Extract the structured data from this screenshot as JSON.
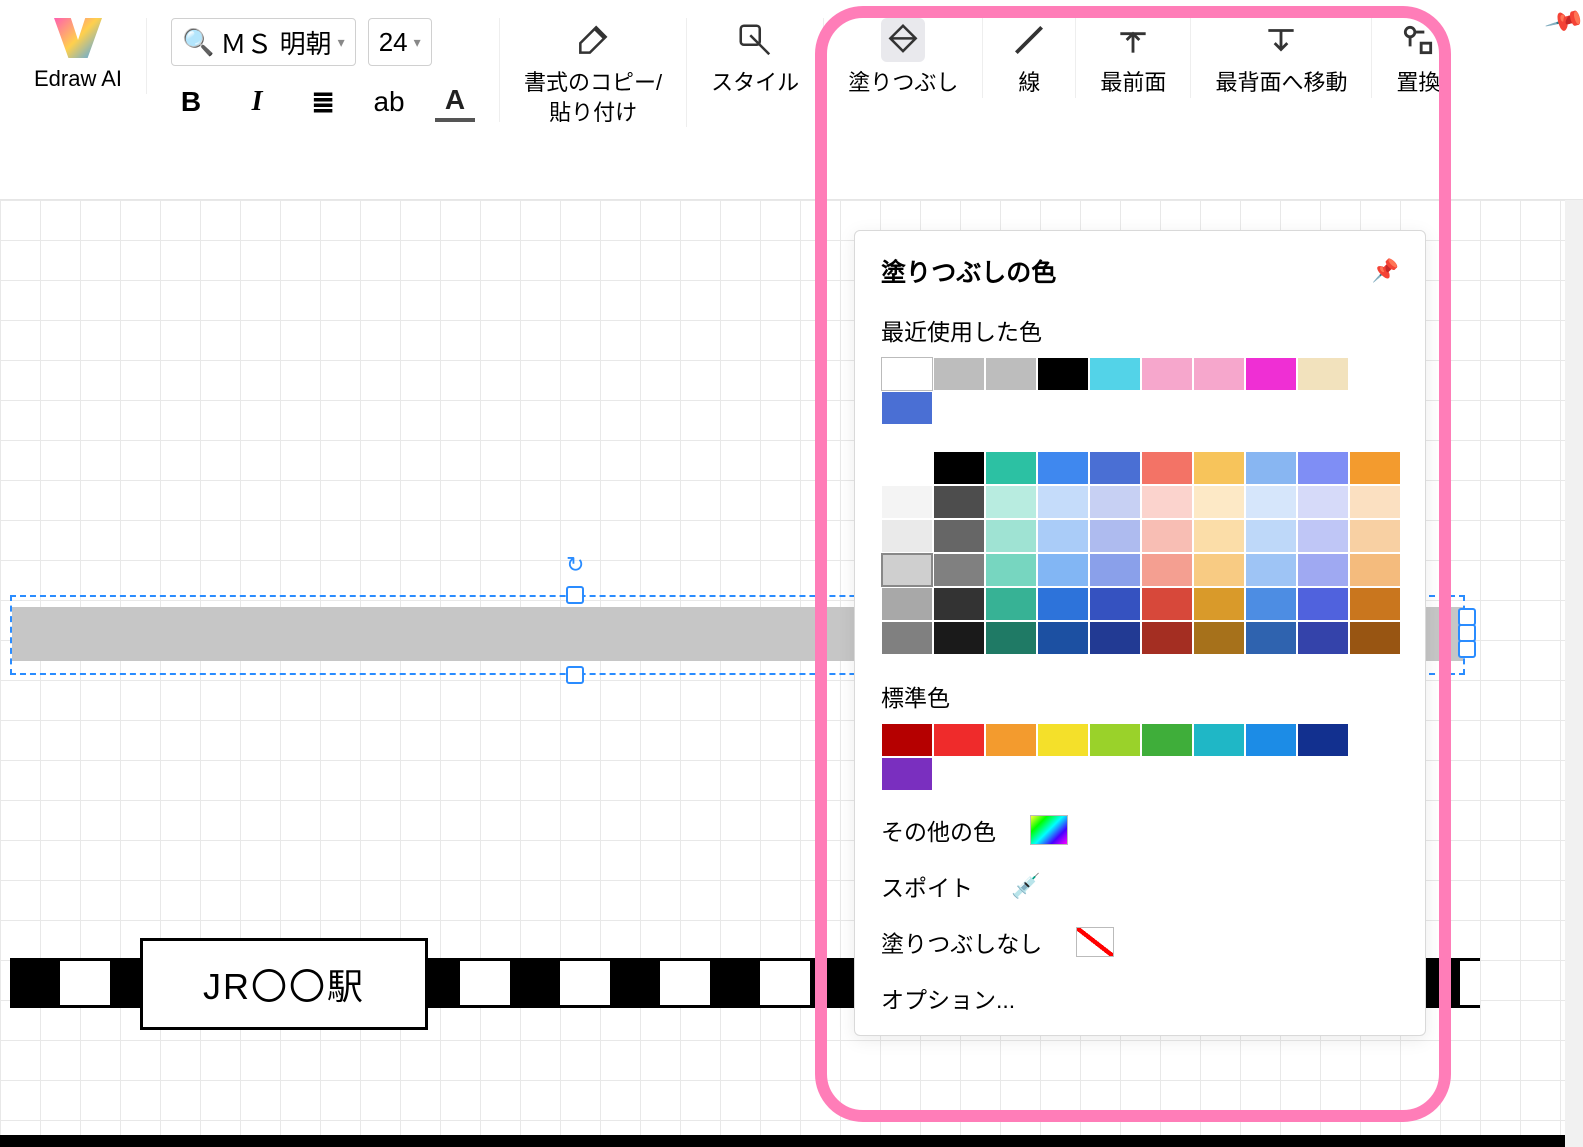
{
  "toolbar": {
    "ai_label": "Edraw AI",
    "font_name": "ＭＳ 明朝",
    "font_size": "24",
    "format_copy_label": "書式のコピー/\n貼り付け",
    "style_label": "スタイル",
    "fill_label": "塗りつぶし",
    "line_label": "線",
    "front_label": "最前面",
    "back_label": "最背面へ移動",
    "replace_label": "置換",
    "char_bold": "B",
    "char_italic": "I",
    "char_align_icon": "≣",
    "char_ab": "ab",
    "char_A": "A"
  },
  "canvas": {
    "station_text": "JR〇〇駅"
  },
  "popup": {
    "title": "塗りつぶしの色",
    "recent_label": "最近使用した色",
    "recent_colors": [
      "#ffffff",
      "#bdbdbd",
      "#bdbdbd",
      "#000000",
      "#53d3e8",
      "#f6a7cc",
      "#f6a7cc",
      "#ef2fd4",
      "#f2e2bd",
      "#4a6fd4"
    ],
    "palette": [
      [
        "#ffffff",
        "#000000",
        "#2cc1a3",
        "#3f88ef",
        "#4a6fd4",
        "#f37366",
        "#f7c45b",
        "#88b6f2",
        "#7f8ef5",
        "#f39b2e"
      ],
      [
        "#f4f4f4",
        "#4d4d4d",
        "#b8ece0",
        "#c5dcfa",
        "#c7d0f3",
        "#fbd3cd",
        "#fde9c6",
        "#d6e6fb",
        "#d6daf9",
        "#fbe0c1"
      ],
      [
        "#eaeaea",
        "#666666",
        "#9fe3d3",
        "#aaccf8",
        "#aebbef",
        "#f8beb4",
        "#fbdda8",
        "#bed8f9",
        "#bfc6f6",
        "#f8d0a3"
      ],
      [
        "#cfcfcf",
        "#808080",
        "#77d6c0",
        "#82b6f4",
        "#8aa0ea",
        "#f49f91",
        "#f8cb83",
        "#9ec4f5",
        "#9fa9f2",
        "#f4bb7d"
      ],
      [
        "#a8a8a8",
        "#333333",
        "#37b295",
        "#2d73da",
        "#3552c0",
        "#d7483a",
        "#d99a2a",
        "#4d8de3",
        "#5062dd",
        "#c9761e"
      ],
      [
        "#808080",
        "#1a1a1a",
        "#1f7a65",
        "#1c50a2",
        "#223a93",
        "#a42e22",
        "#a6711b",
        "#2f63af",
        "#3443aa",
        "#985512"
      ]
    ],
    "standard_label": "標準色",
    "standard_colors": [
      "#b50000",
      "#ef2b2b",
      "#f39b2e",
      "#f4e02a",
      "#9ad22a",
      "#3fae3a",
      "#1fb7c6",
      "#1c8ce6",
      "#12308f",
      "#7a2fbf"
    ],
    "more_label": "その他の色",
    "eyedropper_label": "スポイト",
    "nofill_label": "塗りつぶしなし",
    "options_label": "オプション..."
  }
}
